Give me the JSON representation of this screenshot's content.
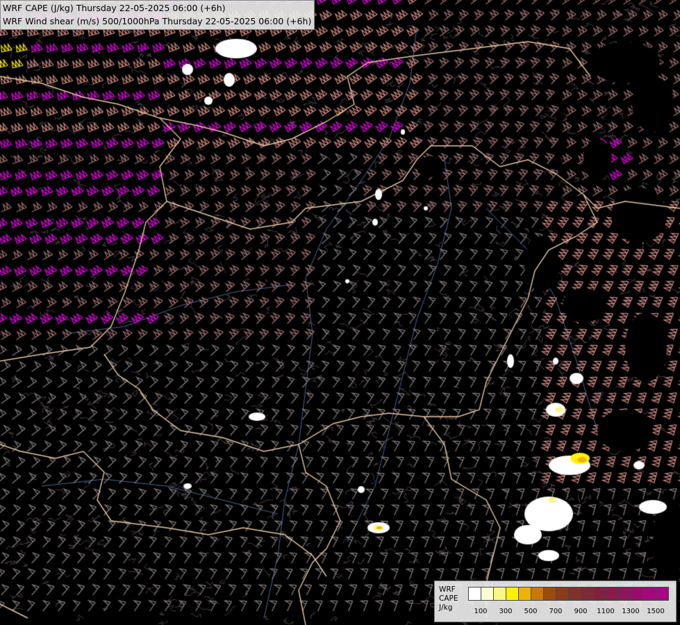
{
  "header": {
    "line1": "WRF CAPE (J/kg) Thursday 22-05-2025 06:00 (+6h)",
    "line2": "WRF Wind shear (m/s) 500/1000hPa Thursday 22-05-2025 06:00 (+6h)"
  },
  "legend": {
    "title_line1": "WRF",
    "title_line2": "CAPE",
    "title_line3": "J/kg",
    "swatch_colors": [
      "#ffffff",
      "#fdfbd0",
      "#fcf58a",
      "#fff200",
      "#f0b400",
      "#c8780a",
      "#9a4c0c",
      "#8c3a18",
      "#84302a",
      "#7e2a36",
      "#82203e",
      "#8a1a4e",
      "#92145e",
      "#9a0c6c",
      "#a2087a",
      "#aa0486"
    ],
    "tick_labels": [
      "100",
      "300",
      "500",
      "700",
      "900",
      "1100",
      "1300",
      "1500"
    ]
  },
  "map": {
    "background_color": "#000000",
    "barb_colors": {
      "weak": "#8a8080",
      "moderate": "#a07070",
      "strong": "#d08a80",
      "very_strong": "#e060d0",
      "extreme": "#ee00ee",
      "peak": "#ffee00"
    },
    "border_color": "#e8c8a0",
    "river_color": "#4a6a9a",
    "terrain_color": "#4a4048"
  }
}
